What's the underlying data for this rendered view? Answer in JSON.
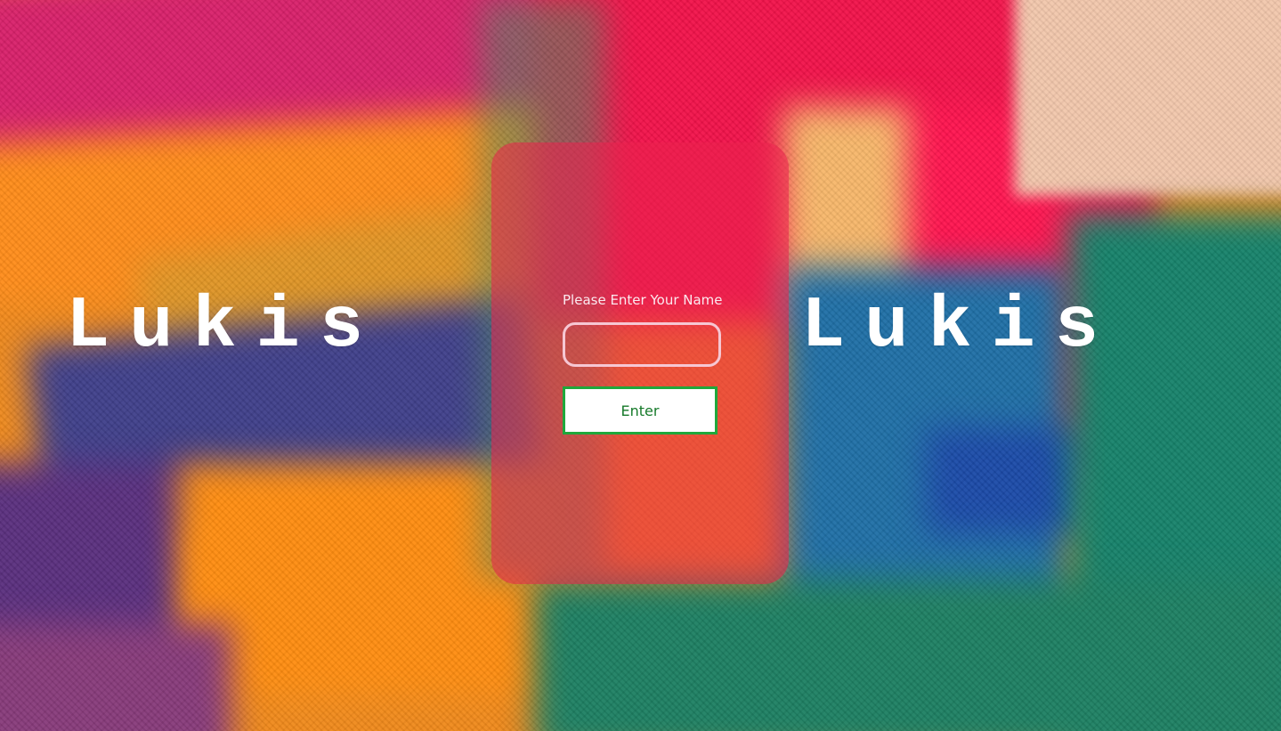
{
  "brand": {
    "left_title": "Lukis",
    "right_title": "Lukis"
  },
  "form": {
    "prompt_label": "Please Enter Your Name",
    "name_value": "",
    "enter_label": "Enter"
  },
  "colors": {
    "card_overlay": "#eb224e",
    "button_border": "#1fa83c",
    "button_text": "#167a2a",
    "title_text": "#ffffff"
  }
}
